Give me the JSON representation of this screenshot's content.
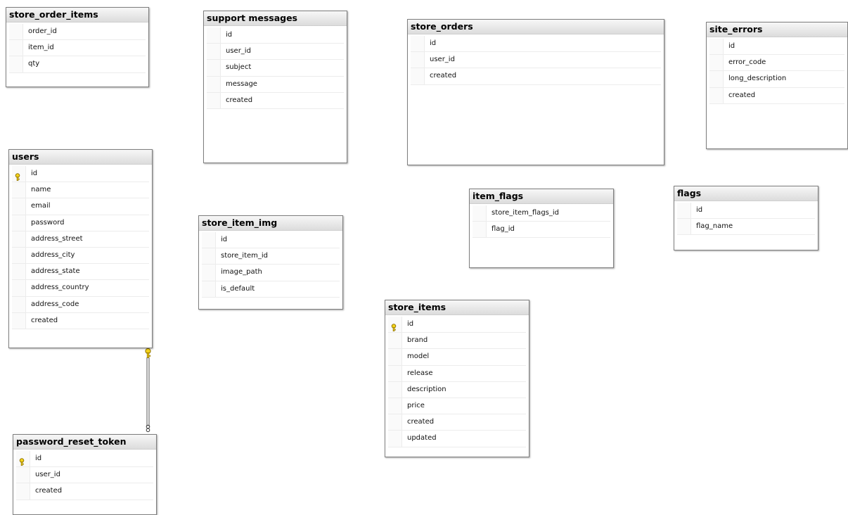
{
  "tables": {
    "store_order_items": {
      "name": "store_order_items",
      "columns": [
        {
          "name": "order_id",
          "pk": false
        },
        {
          "name": "item_id",
          "pk": false
        },
        {
          "name": "qty",
          "pk": false
        }
      ]
    },
    "support_messages": {
      "name": "support messages",
      "columns": [
        {
          "name": "id",
          "pk": false
        },
        {
          "name": "user_id",
          "pk": false
        },
        {
          "name": "subject",
          "pk": false
        },
        {
          "name": "message",
          "pk": false
        },
        {
          "name": "created",
          "pk": false
        }
      ]
    },
    "store_orders": {
      "name": "store_orders",
      "columns": [
        {
          "name": "id",
          "pk": false
        },
        {
          "name": "user_id",
          "pk": false
        },
        {
          "name": "created",
          "pk": false
        }
      ]
    },
    "site_errors": {
      "name": "site_errors",
      "columns": [
        {
          "name": "id",
          "pk": false
        },
        {
          "name": "error_code",
          "pk": false
        },
        {
          "name": "long_description",
          "pk": false
        },
        {
          "name": "created",
          "pk": false
        }
      ]
    },
    "users": {
      "name": "users",
      "columns": [
        {
          "name": "id",
          "pk": true
        },
        {
          "name": "name",
          "pk": false
        },
        {
          "name": "email",
          "pk": false
        },
        {
          "name": "password",
          "pk": false
        },
        {
          "name": "address_street",
          "pk": false
        },
        {
          "name": "address_city",
          "pk": false
        },
        {
          "name": "address_state",
          "pk": false
        },
        {
          "name": "address_country",
          "pk": false
        },
        {
          "name": "address_code",
          "pk": false
        },
        {
          "name": "created",
          "pk": false
        }
      ]
    },
    "store_item_img": {
      "name": "store_item_img",
      "columns": [
        {
          "name": "id",
          "pk": false
        },
        {
          "name": "store_item_id",
          "pk": false
        },
        {
          "name": "image_path",
          "pk": false
        },
        {
          "name": "is_default",
          "pk": false
        }
      ]
    },
    "item_flags": {
      "name": "item_flags",
      "columns": [
        {
          "name": "store_item_flags_id",
          "pk": false
        },
        {
          "name": "flag_id",
          "pk": false
        }
      ]
    },
    "flags": {
      "name": "flags",
      "columns": [
        {
          "name": "id",
          "pk": false
        },
        {
          "name": "flag_name",
          "pk": false
        }
      ]
    },
    "store_items": {
      "name": "store_items",
      "columns": [
        {
          "name": "id",
          "pk": true
        },
        {
          "name": "brand",
          "pk": false
        },
        {
          "name": "model",
          "pk": false
        },
        {
          "name": "release",
          "pk": false
        },
        {
          "name": "description",
          "pk": false
        },
        {
          "name": "price",
          "pk": false
        },
        {
          "name": "created",
          "pk": false
        },
        {
          "name": "updated",
          "pk": false
        }
      ]
    },
    "password_reset_token": {
      "name": "password_reset_token",
      "columns": [
        {
          "name": "id",
          "pk": true
        },
        {
          "name": "user_id",
          "pk": false
        },
        {
          "name": "created",
          "pk": false
        }
      ]
    }
  },
  "relationships": [
    {
      "from": "users",
      "to": "password_reset_token",
      "from_end": "key-icon",
      "to_end": "infinity-icon"
    }
  ],
  "colors": {
    "key": "#e8c200",
    "line": "#555555",
    "header_top": "#f7f7f7",
    "header_bottom": "#dcdcdc"
  }
}
